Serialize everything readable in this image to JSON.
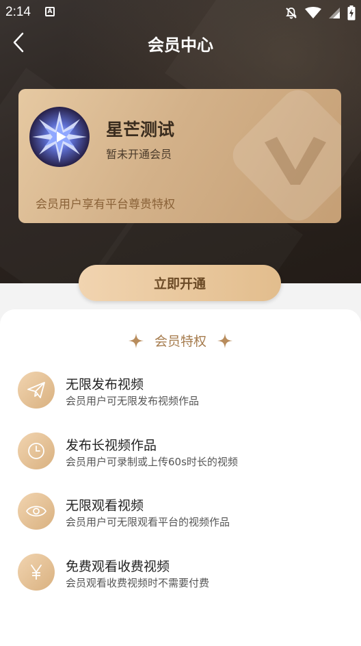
{
  "status_bar": {
    "time": "2:14",
    "notif_letter": "A"
  },
  "header": {
    "title": "会员中心"
  },
  "card": {
    "user_name": "星芒测试",
    "membership_status": "暂未开通会员",
    "note": "会员用户享有平台尊贵特权"
  },
  "activate_button": {
    "label": "立即开通"
  },
  "benefits": {
    "title": "会员特权",
    "items": [
      {
        "icon": "paper-plane-icon",
        "title": "无限发布视频",
        "desc": "会员用户可无限发布视频作品"
      },
      {
        "icon": "clock-icon",
        "title": "发布长视频作品",
        "desc": "会员用户可录制或上传60s时长的视频"
      },
      {
        "icon": "eye-icon",
        "title": "无限观看视频",
        "desc": "会员用户可无限观看平台的视频作品"
      },
      {
        "icon": "yen-icon",
        "title": "免费观看收费视频",
        "desc": "会员观看收费视频时不需要付费"
      }
    ]
  },
  "colors": {
    "gold": "#a67c4e",
    "card_gold": "#d3b189",
    "dark_bg": "#2b2420"
  }
}
